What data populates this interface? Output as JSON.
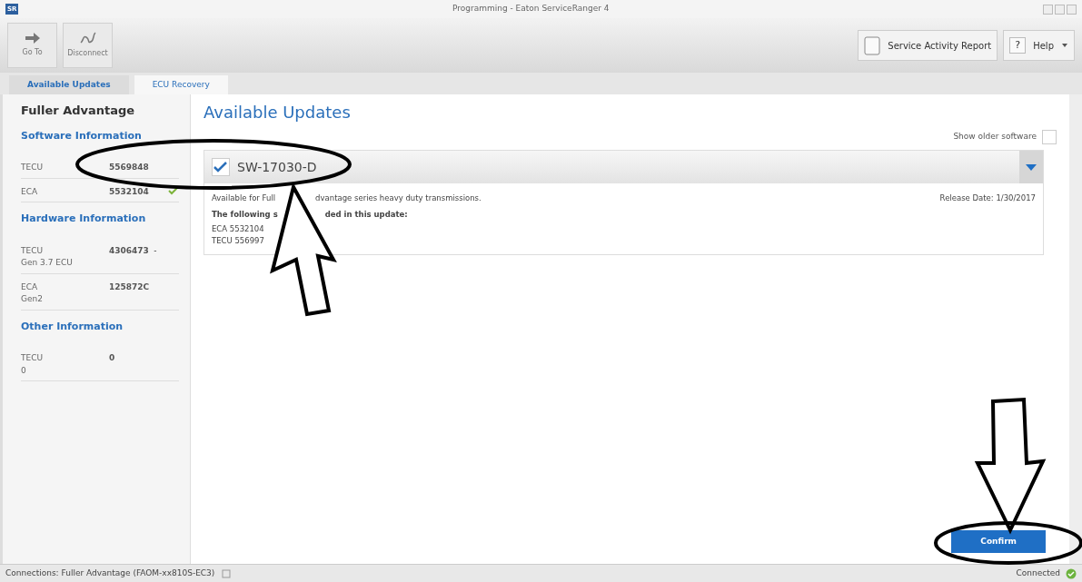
{
  "window": {
    "title": "Programming - Eaton ServiceRanger 4",
    "app_badge": "SR"
  },
  "toolbar": {
    "left": [
      {
        "label": "Go To",
        "kind": "arrow"
      },
      {
        "label": "Disconnect",
        "kind": "plug"
      }
    ],
    "report_button": "Service Activity Report",
    "help_glyph": "?",
    "help_button": "Help"
  },
  "tabs": [
    {
      "label": "Available Updates",
      "selected": true
    },
    {
      "label": "ECU Recovery",
      "selected": false
    }
  ],
  "sidebar": {
    "title": "Fuller Advantage",
    "sections": [
      {
        "heading": "Software Information",
        "rows": [
          {
            "name": "TECU",
            "value": "5569848",
            "ok": false
          },
          {
            "name": "ECA",
            "value": "5532104",
            "ok": true
          }
        ]
      },
      {
        "heading": "Hardware Information",
        "rows": [
          {
            "name": "TECU",
            "sub": "Gen 3.7 ECU",
            "value": "4306473",
            "suffix": "-",
            "ok": false
          },
          {
            "name": "ECA",
            "sub": "Gen2",
            "value": "125872C",
            "ok": false
          }
        ]
      },
      {
        "heading": "Other Information",
        "rows": [
          {
            "name": "TECU",
            "sub": "0",
            "value": "0",
            "ok": false
          }
        ]
      }
    ]
  },
  "main": {
    "title": "Available Updates",
    "show_older": {
      "label": "Show older software",
      "checked": false
    },
    "update": {
      "name": "SW-17030-D",
      "checked": true,
      "expanded": true,
      "description": [
        "Available for Full",
        "dvantage series heavy duty transmissions."
      ],
      "release_date": "Release Date: 1/30/2017",
      "included_heading": [
        "The following s",
        "ded in this update:"
      ],
      "items": [
        "ECA 5532104",
        "TECU 556997"
      ]
    },
    "confirm_button": "Confirm"
  },
  "status_bar": {
    "connection": "Connections: Fuller Advantage (FAOM-xx810S-EC3)",
    "status": "Connected"
  }
}
